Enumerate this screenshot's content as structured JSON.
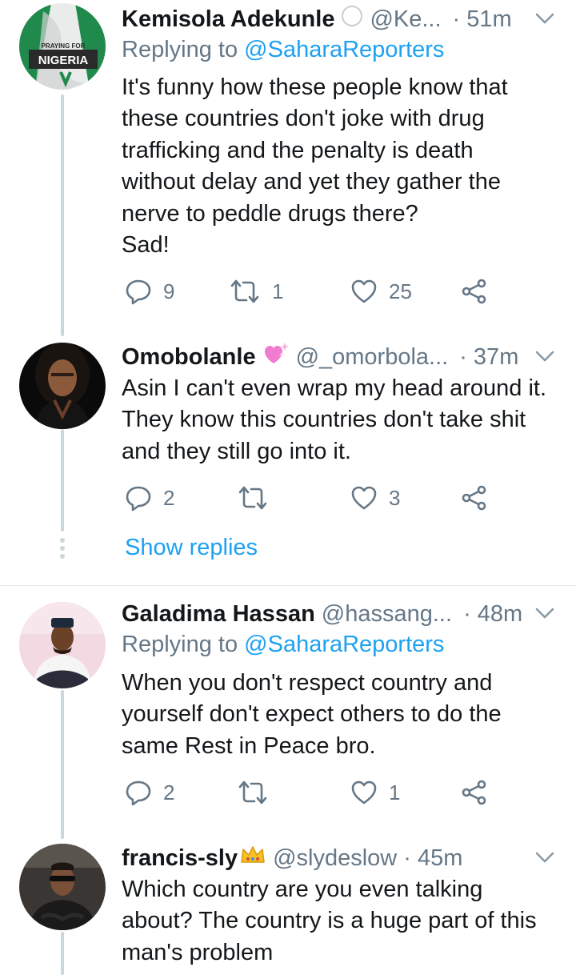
{
  "tweets": [
    {
      "name": "Kemisola Adekunle",
      "handle": "@Ke...",
      "time": "· 51m",
      "replying_label": "Replying to ",
      "replying_to": "@SaharaReporters",
      "text": "It's funny how these people know that\nthese countries don't joke with drug\ntrafficking and the penalty is death\nwithout delay and yet they gather the\nnerve to peddle drugs there?\nSad!",
      "replies": "9",
      "retweets": "1",
      "likes": "25",
      "avatar_text_top": "PRAYING FOR",
      "avatar_text_main": "NIGERIA"
    },
    {
      "name": "Omobolanle",
      "handle": "@_omorbola...",
      "time": "· 37m",
      "text": "Asin I can't even wrap my head around it.\nThey know this countries don't take shit\nand they still go into it.",
      "replies": "2",
      "retweets": "",
      "likes": "3"
    },
    {
      "show_replies": "Show replies"
    },
    {
      "name": "Galadima Hassan",
      "handle": "@hassang...",
      "time": "· 48m",
      "replying_label": "Replying to ",
      "replying_to": "@SaharaReporters",
      "text": "When you don't respect country and\nyourself  don't expect others to do the\nsame Rest in Peace bro.",
      "replies": "2",
      "retweets": "",
      "likes": "1"
    },
    {
      "name": "francis-sly",
      "handle": "@slydeslow",
      "time": "· 45m",
      "text": "Which country are you even talking\nabout? The country is a huge part of this\nman's problem"
    }
  ],
  "colors": {
    "text": "#14171a",
    "secondary": "#657786",
    "link": "#1da1f2",
    "thread_line": "#ccd6dd",
    "divider": "#e1e8ed"
  },
  "icons": [
    "reply-icon",
    "retweet-icon",
    "like-icon",
    "share-icon",
    "chevron-down-icon",
    "sparkle-heart-emoji-icon",
    "crown-emoji-icon",
    "verified-circle-icon"
  ]
}
